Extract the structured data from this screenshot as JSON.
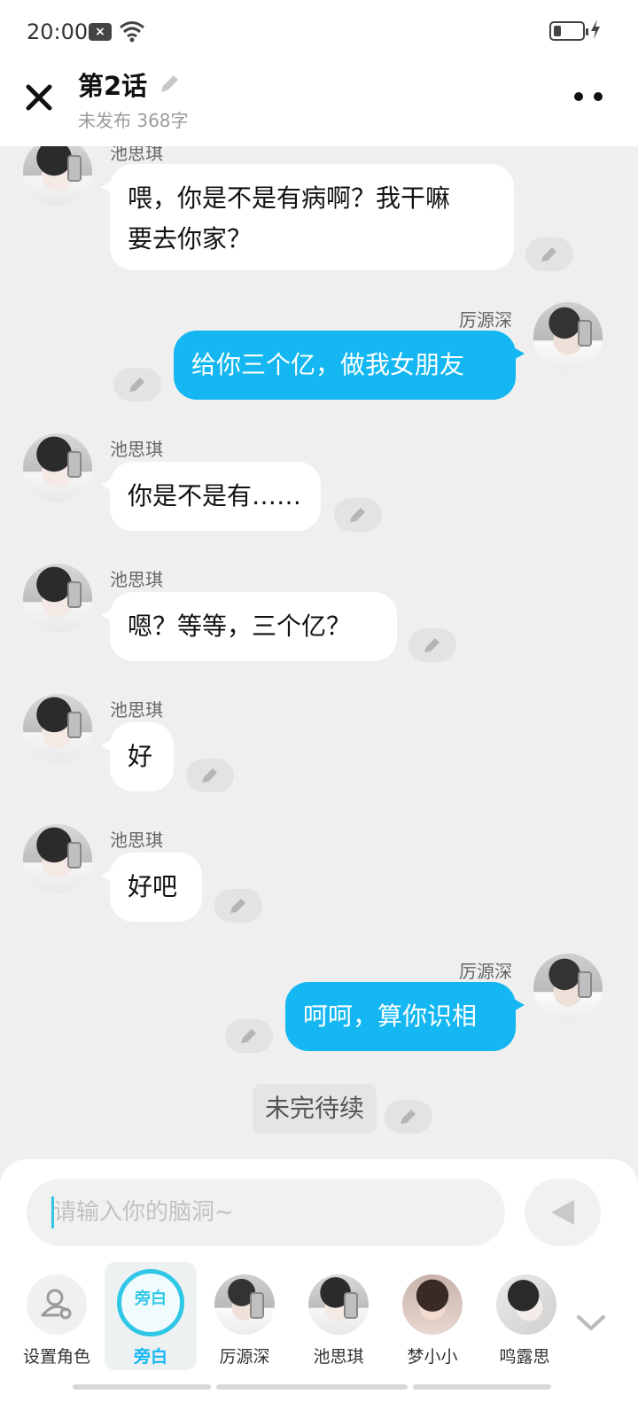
{
  "status": {
    "time": "20:00"
  },
  "header": {
    "title": "第2话",
    "subtitle": "未发布 368字"
  },
  "messages": [
    {
      "speaker": "池思琪",
      "text": "喂，你是不是有病啊？我干嘛要去你家？",
      "line1": "喂，你是不是有病啊？我干嘛",
      "line2": "要去你家？",
      "side": "left"
    },
    {
      "speaker": "厉源深",
      "text": "给你三个亿，做我女朋友",
      "side": "right"
    },
    {
      "speaker": "池思琪",
      "text": "你是不是有……",
      "side": "left"
    },
    {
      "speaker": "池思琪",
      "text": "嗯？等等，三个亿？",
      "side": "left"
    },
    {
      "speaker": "池思琪",
      "text": "好",
      "side": "left"
    },
    {
      "speaker": "池思琪",
      "text": "好吧",
      "side": "left"
    },
    {
      "speaker": "厉源深",
      "text": "呵呵，算你识相",
      "side": "right"
    }
  ],
  "narration": {
    "text": "未完待续"
  },
  "input": {
    "placeholder": "请输入你的脑洞~"
  },
  "roles": [
    {
      "label": "设置角色",
      "selected": false
    },
    {
      "label": "旁白",
      "avatar_text": "旁白",
      "selected": true
    },
    {
      "label": "厉源深",
      "selected": false
    },
    {
      "label": "池思琪",
      "selected": false
    },
    {
      "label": "梦小小",
      "selected": false
    },
    {
      "label": "鸣露思",
      "selected": false
    }
  ],
  "colors": {
    "accent": "#14b7f1",
    "narration_ring": "#2ec7e6",
    "chat_bg": "#efefef"
  }
}
